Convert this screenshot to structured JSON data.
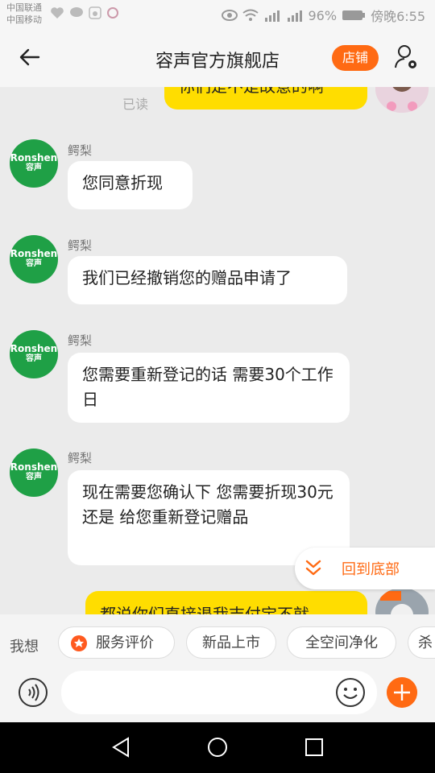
{
  "status_bar": {
    "carrier1": "中国联通",
    "carrier2": "中国移动",
    "battery": "96%",
    "time": "傍晚6:55"
  },
  "header": {
    "title": "容声官方旗舰店",
    "shop_button": "店铺"
  },
  "chat": {
    "read_label": "已读",
    "partial_top_message": "你们是不是故意的啊",
    "messages": [
      {
        "sender": "鳄梨",
        "avatar_brand": "Ronshen",
        "avatar_cn": "容声",
        "text": "您同意折现"
      },
      {
        "sender": "鳄梨",
        "avatar_brand": "Ronshen",
        "avatar_cn": "容声",
        "text": "我们已经撤销您的赠品申请了"
      },
      {
        "sender": "鳄梨",
        "avatar_brand": "Ronshen",
        "avatar_cn": "容声",
        "text": "您需要重新登记的话 需要30个工作日"
      },
      {
        "sender": "鳄梨",
        "avatar_brand": "Ronshen",
        "avatar_cn": "容声",
        "text": "现在需要您确认下 您需要折现30元 还是 给您重新登记赠品"
      }
    ],
    "partial_bottom_message": "都说你们直接退我吉付宝不就"
  },
  "back_to_bottom": "回到底部",
  "quick_bar": {
    "prefix": "我想",
    "chips": [
      "服务评价",
      "新品上市",
      "全空间净化",
      "杀"
    ]
  },
  "colors": {
    "accent": "#ff6a13",
    "bubble_mine": "#ffdd00",
    "brand_green": "#1fa046"
  }
}
